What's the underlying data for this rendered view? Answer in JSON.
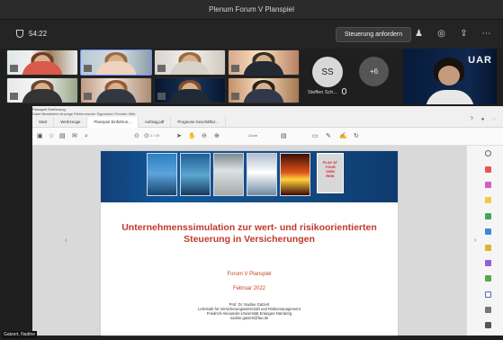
{
  "window": {
    "title": "Plenum Forum V Planspiel"
  },
  "call": {
    "timer": "54:22",
    "request_control": "Steuerung anfordern"
  },
  "participants": {
    "initials": "SS",
    "name": "Steffen Sch...",
    "more": "+6",
    "uar_logo": "UAR"
  },
  "pdf": {
    "window_title": "Planspiel Einführung",
    "menu": "Datei   Bearbeiten   Anzeige   Elektronische Signaturen   Fenster   Hilfe",
    "tabs": [
      "Start",
      "Werkzeuge",
      "Planspiel Einführun...",
      "Auftrag.pdf",
      "Prognose Geschäftsz..."
    ],
    "page": "1 / 19",
    "zoom": "Zoom",
    "title": "Unternehmenssimulation zur wert- und risikoorientierten Steuerung in Versicherungen",
    "subtitle1": "Forum V Planspiel",
    "subtitle2": "Februar 2022",
    "author_lines": [
      "Prof. Dr. Nadine Gatzert",
      "Lehrstuhl für Versicherungswirtschaft und Risikomanagement",
      "Friedrich-Alexander-Universität Erlangen-Nürnberg",
      "nadine.gatzert@fau.de"
    ],
    "poster_text": "PLAY AT YOUR OWN RISK"
  },
  "footer": {
    "presenter": "Gatzert, Nadine"
  },
  "colors": {
    "accent": "#c0392b",
    "teams_bg": "#1f1f1f",
    "doc_blue": "#11589b"
  }
}
